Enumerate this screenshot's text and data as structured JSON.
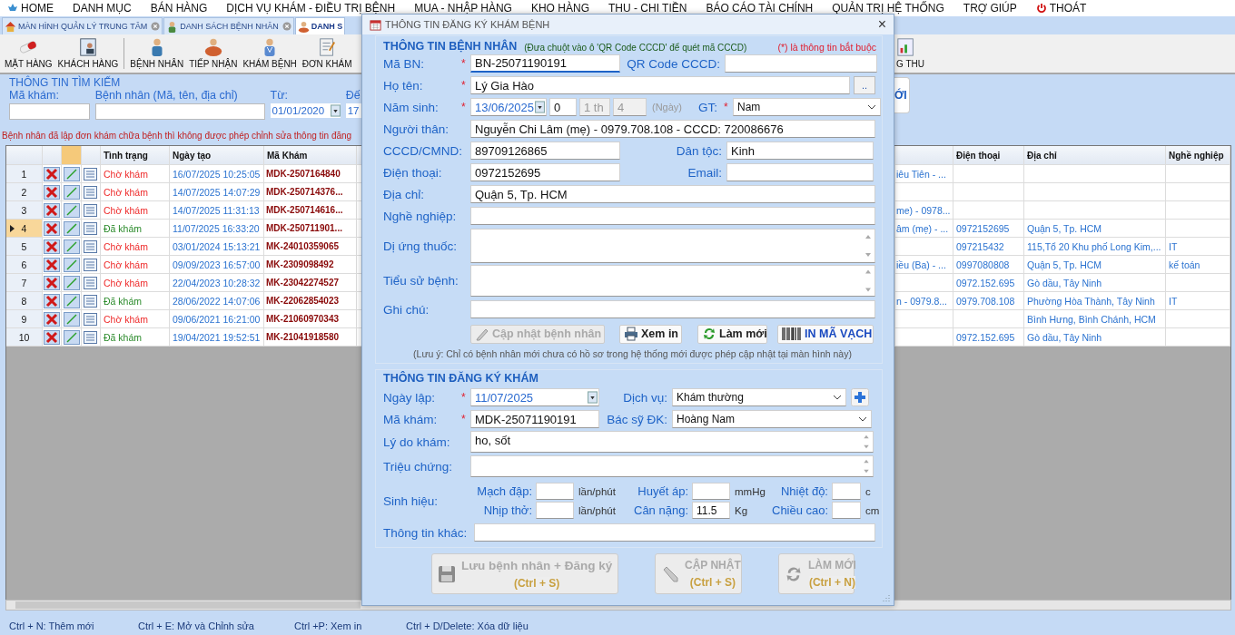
{
  "menu": [
    "HOME",
    "DANH MỤC",
    "BÁN HÀNG",
    "DỊCH VỤ KHÁM - ĐIỀU TRỊ BỆNH",
    "MUA - NHẬP HÀNG",
    "KHO HÀNG",
    "THU - CHI TIỀN",
    "BÁO CÁO TÀI CHÍNH",
    "QUẢN TRỊ HỆ THỐNG",
    "TRỢ GIÚP",
    "THOÁT"
  ],
  "tabs": [
    {
      "label": "MÀN HÌNH QUẢN LÝ TRUNG TÂM",
      "closable": true,
      "selected": false
    },
    {
      "label": "DANH SÁCH BỆNH NHÂN",
      "closable": true,
      "selected": false
    },
    {
      "label": "DANH S",
      "closable": false,
      "selected": true
    }
  ],
  "toolbar": [
    "MẶT HÀNG",
    "KHÁCH HÀNG",
    "BỆNH NHÂN",
    "TIẾP NHẬN",
    "KHÁM BỆNH",
    "ĐƠN KHÁM"
  ],
  "toolbar_right": "G THU",
  "search": {
    "title": "THÔNG TIN TÌM KIẾM",
    "code_label": "Mã khám:",
    "patient_label": "Bệnh nhân (Mã, tên, địa chỉ)",
    "from_label": "Từ:",
    "from_value": "01/01/2020",
    "to_label": "Đế",
    "to_value": "17",
    "button": "ỚI"
  },
  "warning": "Bệnh nhân đã lập đơn khám chữa bệnh thì không được phép chỉnh sửa thông tin đăng",
  "table": {
    "columns": [
      "Tình trạng",
      "Ngày tạo",
      "Mã Khám",
      "Điện thoại",
      "Địa chỉ",
      "Nghề nghiệp"
    ],
    "rows": [
      {
        "no": "1",
        "status": "Chờ khám",
        "done": false,
        "created": "16/07/2025 10:25:05",
        "code": "MDK-2507164840",
        "column_8": "iêu Tiên - ...",
        "selected": false
      },
      {
        "no": "2",
        "status": "Chờ khám",
        "done": false,
        "created": "14/07/2025 14:07:29",
        "code": "MDK-250714376...",
        "selected": false
      },
      {
        "no": "3",
        "status": "Chờ khám",
        "done": false,
        "created": "14/07/2025 11:31:13",
        "code": "MDK-250714616...",
        "column_8": "me) - 0978...",
        "selected": false
      },
      {
        "no": "4",
        "status": "Đã khám",
        "done": true,
        "created": "11/07/2025 16:33:20",
        "code": "MDK-250711901...",
        "column_8": "âm (mẹ) - ...",
        "phone": "0972152695",
        "address": "Quận 5, Tp. HCM",
        "selected": true
      },
      {
        "no": "5",
        "status": "Chờ khám",
        "done": false,
        "created": "03/01/2024 15:13:21",
        "code": "MK-24010359065",
        "phone": "097215432",
        "address": "115,Tổ 20 Khu phố Long Kim,...",
        "job": "IT",
        "selected": false
      },
      {
        "no": "6",
        "status": "Chờ khám",
        "done": false,
        "created": "09/09/2023 16:57:00",
        "code": "MK-2309098492",
        "column_8": "iều (Ba) - ...",
        "phone": "0997080808",
        "address": "Quận 5, Tp. HCM",
        "job": "kế toán",
        "selected": false
      },
      {
        "no": "7",
        "status": "Chờ khám",
        "done": false,
        "created": "22/04/2023 10:28:32",
        "code": "MK-23042274527",
        "phone": "0972.152.695",
        "address": "Gò dầu, Tây Ninh",
        "selected": false
      },
      {
        "no": "8",
        "status": "Đã khám",
        "done": true,
        "created": "28/06/2022 14:07:06",
        "code": "MK-22062854023",
        "column_8": "n -  0979.8...",
        "phone": "0979.708.108",
        "address": "Phường Hòa Thành, Tây Ninh",
        "job": "IT",
        "selected": false
      },
      {
        "no": "9",
        "status": "Chờ khám",
        "done": false,
        "created": "09/06/2021 16:21:00",
        "code": "MK-21060970343",
        "address": "Bình Hưng, Bình Chánh, HCM",
        "selected": false
      },
      {
        "no": "10",
        "status": "Đã khám",
        "done": true,
        "created": "19/04/2021 19:52:51",
        "code": "MK-21041918580",
        "phone": "0972.152.695",
        "address": "Gò dầu, Tây Ninh",
        "selected": false
      }
    ]
  },
  "status_bar": [
    "Ctrl + N: Thêm mới",
    "Ctrl + E: Mở và Chỉnh sửa",
    "Ctrl +P: Xem in",
    "Ctrl + D/Delete: Xóa dữ liệu"
  ],
  "dialog": {
    "title": "THÔNG TIN ĐĂNG KÝ KHÁM BỆNH",
    "close": "×",
    "patient": {
      "title": "THÔNG TIN BỆNH NHÂN",
      "hint": "(Đưa chuột vào ô 'QR Code CCCD' để quét mã CCCD)",
      "required_note": "(*) là thông tin bắt buộc",
      "code": {
        "label": "Mã BN:",
        "mark": "*",
        "value": "BN-25071190191"
      },
      "qr": {
        "label": "QR Code CCCD:"
      },
      "name": {
        "label": "Họ tên:",
        "mark": "*",
        "value": "Lý Gia Hào",
        "button": ".."
      },
      "birth": {
        "label": "Năm sinh:",
        "mark": "*",
        "date": "13/06/2025",
        "years": "0",
        "months": "1 th",
        "days": "4",
        "unit": "(Ngày)"
      },
      "gender": {
        "label": "GT:",
        "mark": "*",
        "value": "Nam"
      },
      "relative": {
        "label": "Người thân:",
        "value": "Nguyễn Chi Lâm (mẹ) - 0979.708.108 - CCCD: 720086676"
      },
      "id_card": {
        "label": "CCCD/CMND:",
        "value": "89709126865"
      },
      "ethnicity": {
        "label": "Dân tộc:",
        "value": "Kinh"
      },
      "phone": {
        "label": "Điện thoại:",
        "value": "0972152695"
      },
      "email": {
        "label": "Email:"
      },
      "address": {
        "label": "Địa chỉ:",
        "value": "Quận 5, Tp. HCM"
      },
      "job": {
        "label": "Nghề nghiệp:"
      },
      "allergy": {
        "label": "Dị ứng thuốc:"
      },
      "history": {
        "label": "Tiểu sử bệnh:"
      },
      "note": {
        "label": "Ghi chú:"
      },
      "buttons": [
        {
          "label": "Cập nhật bệnh nhân",
          "disabled": true
        },
        {
          "label": "Xem in",
          "disabled": false
        },
        {
          "label": "Làm mới",
          "disabled": false
        },
        {
          "label": "IN MÃ VẠCH",
          "disabled": false
        }
      ],
      "footnote": "(Lưu ý: Chỉ có bệnh nhân mới chưa có hồ sơ trong hệ thống mới được phép cập nhật tại màn hình này)"
    },
    "registration": {
      "title": "THÔNG TIN ĐĂNG KÝ KHÁM",
      "date": {
        "label": "Ngày lập:",
        "mark": "*",
        "value": "11/07/2025"
      },
      "service": {
        "label": "Dịch vụ:",
        "value": "Khám thường"
      },
      "code": {
        "label": "Mã khám:",
        "mark": "*",
        "value": "MDK-25071190191"
      },
      "doctor": {
        "label": "Bác sỹ ĐK:",
        "value": "Hoàng Nam"
      },
      "reason": {
        "label": "Lý do khám:",
        "value": "ho, sốt"
      },
      "symptoms": {
        "label": "Triệu chứng:"
      },
      "vitals_label": "Sinh hiệu:",
      "vitals": [
        {
          "label": "Mạch đập:",
          "unit": "lần/phút"
        },
        {
          "label": "Huyết áp:",
          "unit": "mmHg"
        },
        {
          "label": "Nhiệt độ:",
          "unit": "c"
        },
        {
          "label": "Nhịp thở:",
          "unit": "lần/phút"
        },
        {
          "label": "Cân nặng:",
          "value": "11.5",
          "unit": "Kg"
        },
        {
          "label": "Chiều cao:",
          "unit": "cm"
        }
      ],
      "other": {
        "label": "Thông tin khác:"
      }
    },
    "actions": [
      {
        "label": "Lưu bệnh nhân + Đăng ký",
        "shortcut": "(Ctrl + S)",
        "disabled": true
      },
      {
        "label": "CẬP NHẬT",
        "shortcut": "(Ctrl + S)",
        "disabled": true
      },
      {
        "label": "LÀM MỚI",
        "shortcut": "(Ctrl + N)",
        "disabled": true
      }
    ]
  }
}
